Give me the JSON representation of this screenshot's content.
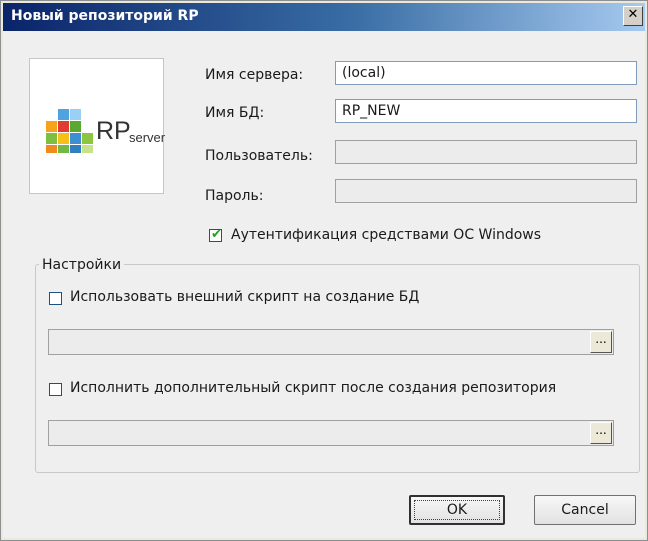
{
  "window": {
    "title": "Новый репозиторий RP",
    "close_glyph": "✕"
  },
  "logo": {
    "rp": "RP",
    "server": "server",
    "icon": "colorful-blocks-logo"
  },
  "form": {
    "server_label": "Имя сервера:",
    "server_value": "(local)",
    "db_label": "Имя БД:",
    "db_value": "RP_NEW",
    "user_label": "Пользователь:",
    "password_label": "Пароль:",
    "windows_auth_label": "Аутентификация средствами ОС Windows",
    "windows_auth_checked": true
  },
  "settings": {
    "title": "Настройки",
    "external_script_label": "Использовать внешний скрипт на создание БД",
    "external_script_checked": false,
    "extra_script_label": "Исполнить дополнительный скрипт после создания репозитория",
    "extra_script_checked": false,
    "browse_label": "..."
  },
  "buttons": {
    "ok": "OK",
    "cancel": "Cancel"
  },
  "colors": {
    "title_start": "#0a246a",
    "title_end": "#a6caf0",
    "dialog_bg": "#efefef",
    "check_tick": "#21a121"
  }
}
